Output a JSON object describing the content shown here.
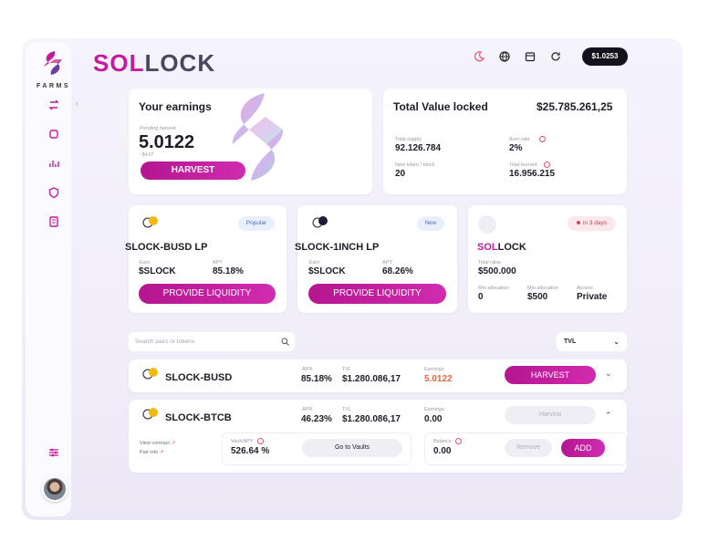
{
  "brand": {
    "sol": "SOL",
    "lock": "LOCK",
    "sidebar_caption": "FARMS"
  },
  "header": {
    "price": "$1.0253"
  },
  "sidebar": {
    "items": [
      {
        "icon": "swap-icon"
      },
      {
        "icon": "square-icon"
      },
      {
        "icon": "chart-icon"
      },
      {
        "icon": "shield-icon"
      },
      {
        "icon": "document-icon"
      }
    ],
    "collapse_glyph": "›",
    "settings_icon": "sliders-icon"
  },
  "earnings": {
    "title": "Your earnings",
    "pending_label": "Pending harvest",
    "value": "5.0122",
    "sub": "~$4.07",
    "harvest_label": "HARVEST"
  },
  "tvl": {
    "title": "Total Value locked",
    "value": "$25.785.261,25",
    "stats": [
      {
        "label": "Total supply",
        "value": "92.126.784"
      },
      {
        "label": "Burn rate",
        "value": "2%"
      },
      {
        "label": "New token / block",
        "value": "20"
      },
      {
        "label": "Total burned",
        "value": "16.956.215"
      }
    ]
  },
  "pools": [
    {
      "name": "SLOCK-BUSD LP",
      "badge": "Popular",
      "earn_label": "Earn",
      "earn": "$SLOCK",
      "apy_label": "APY",
      "apy": "85.18%",
      "button": "PROVIDE LIQUIDITY"
    },
    {
      "name": "SLOCK-1INCH LP",
      "badge": "New",
      "earn_label": "Earn",
      "earn": "$SLOCK",
      "apy_label": "APY",
      "apy": "68.26%",
      "button": "PROVIDE LIQUIDITY"
    }
  ],
  "launch": {
    "name_sol": "SOL",
    "name_lock": "LOCK",
    "badge": "in 3 days",
    "raise_label": "Total raise",
    "raise": "$500.000",
    "min_label": "Min allocation",
    "min": "0",
    "max_label": "Min allocation",
    "max": "$500",
    "access_label": "Access",
    "access": "Private"
  },
  "filters": {
    "search_placeholder": "Search pairs or tokens",
    "sort_value": "TVL"
  },
  "farms": [
    {
      "pair": "SLOCK-BUSD",
      "apr_label": "APR",
      "apr": "85.18%",
      "tvl_label": "TVL",
      "tvl": "$1.280.086,17",
      "earnings_label": "Earnings",
      "earnings": "5.0122",
      "action": "HARVEST",
      "chevron": "⌄"
    },
    {
      "pair": "SLOCK-BTCB",
      "apr_label": "APR",
      "apr": "46.23%",
      "tvl_label": "TVL",
      "tvl": "$1.280.086,17",
      "earnings_label": "Earnings",
      "earnings": "0.00",
      "action": "Harvest",
      "chevron": "⌃"
    }
  ],
  "farm_details": {
    "view_contract": "View contract",
    "pair_info": "Pair info",
    "vault_apy_label": "Vault APY",
    "vault_apy": "526.64 %",
    "go_to_vaults": "Go to Vaults",
    "balance_label": "Balance",
    "balance": "0.00",
    "remove": "Remove",
    "add": "ADD"
  },
  "colors": {
    "accent": "#c41a9c",
    "dark": "#14131c",
    "earnings_orange": "#e8663d"
  }
}
